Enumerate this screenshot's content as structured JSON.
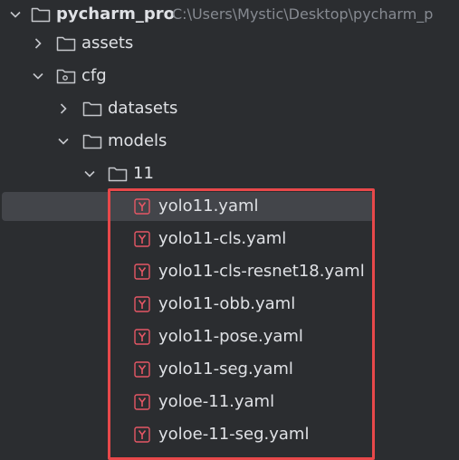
{
  "project": {
    "name": "pycharm_pro",
    "path": "C:\\Users\\Mystic\\Desktop\\pycharm_p"
  },
  "folders": {
    "assets": "assets",
    "cfg": "cfg",
    "datasets": "datasets",
    "models": "models",
    "v11": "11"
  },
  "files": [
    "yolo11.yaml",
    "yolo11-cls.yaml",
    "yolo11-cls-resnet18.yaml",
    "yolo11-obb.yaml",
    "yolo11-pose.yaml",
    "yolo11-seg.yaml",
    "yoloe-11.yaml",
    "yoloe-11-seg.yaml"
  ],
  "colors": {
    "background": "#2b2d30",
    "selection": "#43454a",
    "highlight_border": "#e8484a",
    "text": "#dfe1e5",
    "path_text": "#868a91",
    "yaml_icon": "#e55765"
  }
}
